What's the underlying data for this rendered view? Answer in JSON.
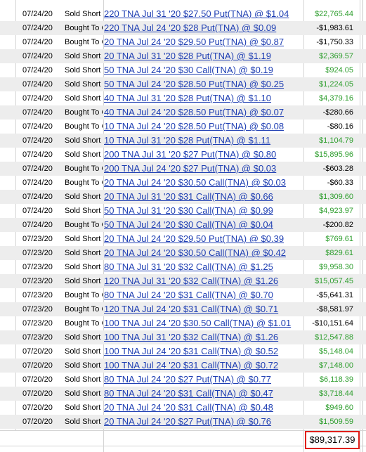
{
  "rows": [
    {
      "date": "07/24/20",
      "action": "Sold Short",
      "desc": "220 TNA Jul 31 '20 $27.50 Put(TNA) @ $1.04",
      "amount": "$22,765.44",
      "positive": true
    },
    {
      "date": "07/24/20",
      "action": "Bought To Close",
      "desc": "220 TNA Jul 24 '20 $28 Put(TNA) @ $0.09",
      "amount": "-$1,983.61",
      "positive": false
    },
    {
      "date": "07/24/20",
      "action": "Bought To Close",
      "desc": "20 TNA Jul 24 '20 $29.50 Put(TNA) @ $0.87",
      "amount": "-$1,750.33",
      "positive": false
    },
    {
      "date": "07/24/20",
      "action": "Sold Short",
      "desc": "20 TNA Jul 31 '20 $28 Put(TNA) @ $1.19",
      "amount": "$2,369.57",
      "positive": true
    },
    {
      "date": "07/24/20",
      "action": "Sold Short",
      "desc": "50 TNA Jul 24 '20 $30 Call(TNA) @ $0.19",
      "amount": "$924.05",
      "positive": true
    },
    {
      "date": "07/24/20",
      "action": "Sold Short",
      "desc": "50 TNA Jul 24 '20 $28.50 Put(TNA) @ $0.25",
      "amount": "$1,224.05",
      "positive": true
    },
    {
      "date": "07/24/20",
      "action": "Sold Short",
      "desc": "40 TNA Jul 31 '20 $28 Put(TNA) @ $1.10",
      "amount": "$4,379.16",
      "positive": true
    },
    {
      "date": "07/24/20",
      "action": "Bought To Close",
      "desc": "40 TNA Jul 24 '20 $28.50 Put(TNA) @ $0.07",
      "amount": "-$280.66",
      "positive": false
    },
    {
      "date": "07/24/20",
      "action": "Bought To Close",
      "desc": "10 TNA Jul 24 '20 $28.50 Put(TNA) @ $0.08",
      "amount": "-$80.16",
      "positive": false
    },
    {
      "date": "07/24/20",
      "action": "Sold Short",
      "desc": "10 TNA Jul 31 '20 $28 Put(TNA) @ $1.11",
      "amount": "$1,104.79",
      "positive": true
    },
    {
      "date": "07/24/20",
      "action": "Sold Short",
      "desc": "200 TNA Jul 31 '20 $27 Put(TNA) @ $0.80",
      "amount": "$15,895.96",
      "positive": true
    },
    {
      "date": "07/24/20",
      "action": "Bought To Close",
      "desc": "200 TNA Jul 24 '20 $27 Put(TNA) @ $0.03",
      "amount": "-$603.28",
      "positive": false
    },
    {
      "date": "07/24/20",
      "action": "Bought To Close",
      "desc": "20 TNA Jul 24 '20 $30.50 Call(TNA) @ $0.03",
      "amount": "-$60.33",
      "positive": false
    },
    {
      "date": "07/24/20",
      "action": "Sold Short",
      "desc": "20 TNA Jul 31 '20 $31 Call(TNA) @ $0.66",
      "amount": "$1,309.60",
      "positive": true
    },
    {
      "date": "07/24/20",
      "action": "Sold Short",
      "desc": "50 TNA Jul 31 '20 $30 Call(TNA) @ $0.99",
      "amount": "$4,923.97",
      "positive": true
    },
    {
      "date": "07/24/20",
      "action": "Bought To Close",
      "desc": "50 TNA Jul 24 '20 $30 Call(TNA) @ $0.04",
      "amount": "-$200.82",
      "positive": false
    },
    {
      "date": "07/23/20",
      "action": "Sold Short",
      "desc": "20 TNA Jul 24 '20 $29.50 Put(TNA) @ $0.39",
      "amount": "$769.61",
      "positive": true
    },
    {
      "date": "07/23/20",
      "action": "Sold Short",
      "desc": "20 TNA Jul 24 '20 $30.50 Call(TNA) @ $0.42",
      "amount": "$829.61",
      "positive": true
    },
    {
      "date": "07/23/20",
      "action": "Sold Short",
      "desc": "80 TNA Jul 31 '20 $32 Call(TNA) @ $1.25",
      "amount": "$9,958.30",
      "positive": true
    },
    {
      "date": "07/23/20",
      "action": "Sold Short",
      "desc": "120 TNA Jul 31 '20 $32 Call(TNA) @ $1.26",
      "amount": "$15,057.45",
      "positive": true
    },
    {
      "date": "07/23/20",
      "action": "Bought To Close",
      "desc": "80 TNA Jul 24 '20 $31 Call(TNA) @ $0.70",
      "amount": "-$5,641.31",
      "positive": false
    },
    {
      "date": "07/23/20",
      "action": "Bought To Close",
      "desc": "120 TNA Jul 24 '20 $31 Call(TNA) @ $0.71",
      "amount": "-$8,581.97",
      "positive": false
    },
    {
      "date": "07/23/20",
      "action": "Bought To Close",
      "desc": "100 TNA Jul 24 '20 $30.50 Call(TNA) @ $1.01",
      "amount": "-$10,151.64",
      "positive": false
    },
    {
      "date": "07/23/20",
      "action": "Sold Short",
      "desc": "100 TNA Jul 31 '20 $32 Call(TNA) @ $1.26",
      "amount": "$12,547.88",
      "positive": true
    },
    {
      "date": "07/20/20",
      "action": "Sold Short",
      "desc": "100 TNA Jul 24 '20 $31 Call(TNA) @ $0.52",
      "amount": "$5,148.04",
      "positive": true
    },
    {
      "date": "07/20/20",
      "action": "Sold Short",
      "desc": "100 TNA Jul 24 '20 $31 Call(TNA) @ $0.72",
      "amount": "$7,148.00",
      "positive": true
    },
    {
      "date": "07/20/20",
      "action": "Sold Short",
      "desc": "80 TNA Jul 24 '20 $27 Put(TNA) @ $0.77",
      "amount": "$6,118.39",
      "positive": true
    },
    {
      "date": "07/20/20",
      "action": "Sold Short",
      "desc": "80 TNA Jul 24 '20 $31 Call(TNA) @ $0.47",
      "amount": "$3,718.44",
      "positive": true
    },
    {
      "date": "07/20/20",
      "action": "Sold Short",
      "desc": "20 TNA Jul 24 '20 $31 Call(TNA) @ $0.48",
      "amount": "$949.60",
      "positive": true
    },
    {
      "date": "07/20/20",
      "action": "Sold Short",
      "desc": "20 TNA Jul 24 '20 $27 Put(TNA) @ $0.76",
      "amount": "$1,509.59",
      "positive": true
    }
  ],
  "total": "$89,317.39",
  "colors": {
    "positive": "#2e9e2e",
    "negative": "#000000",
    "link": "#1f3fb3",
    "highlight": "#e0201b"
  }
}
